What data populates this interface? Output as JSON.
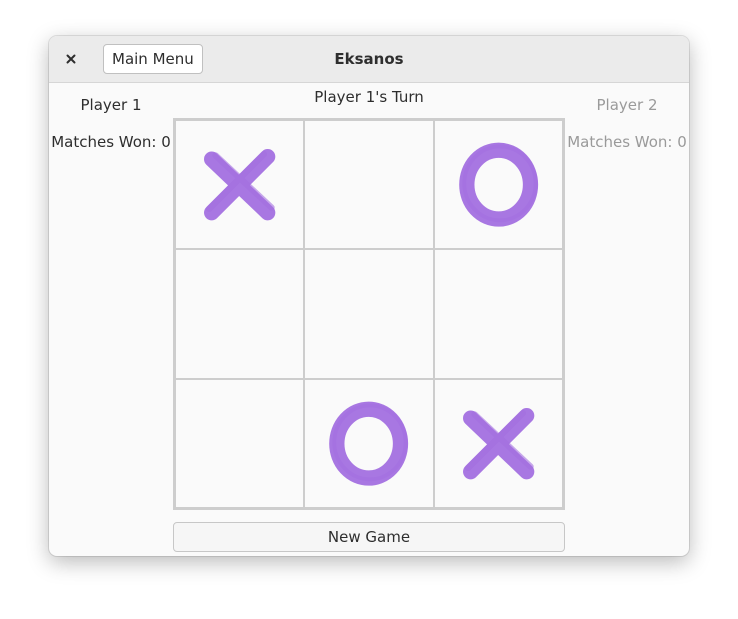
{
  "window": {
    "title": "Eksanos",
    "close_icon": "close-icon",
    "main_menu_label": "Main Menu"
  },
  "players": {
    "p1": {
      "name": "Player 1",
      "matches_won": "Matches Won: 0"
    },
    "p2": {
      "name": "Player 2",
      "matches_won": "Matches Won: 0"
    }
  },
  "status": "Player 1's Turn",
  "board": [
    "X",
    "",
    "O",
    "",
    "",
    "",
    "",
    "O",
    "X"
  ],
  "new_game_label": "New Game",
  "colors": {
    "mark": "#a370e0",
    "inactive_player": "#9a9a9a"
  }
}
